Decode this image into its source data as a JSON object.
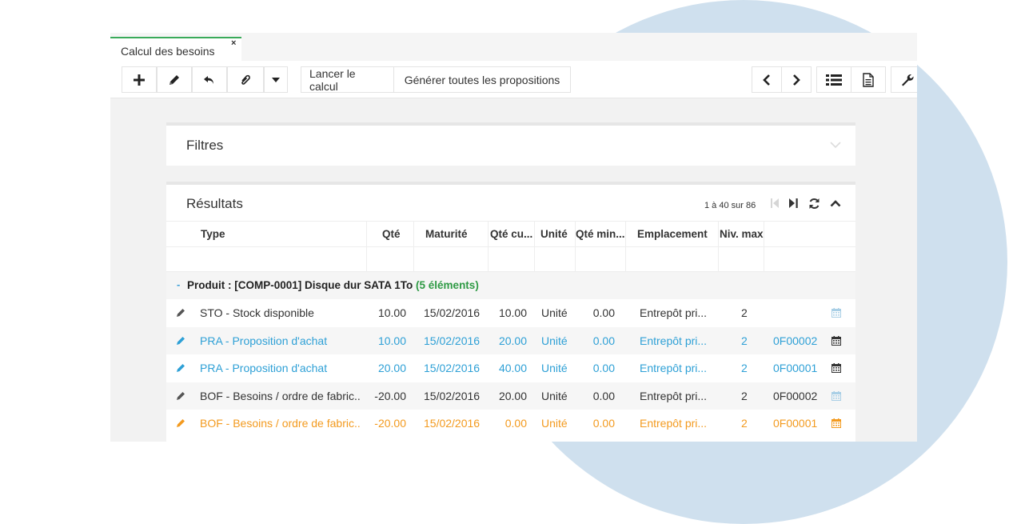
{
  "tab": {
    "label": "Calcul des besoins",
    "close": "×"
  },
  "toolbar": {
    "icons": [
      "plus-icon",
      "pencil-icon",
      "undo-icon",
      "paperclip-icon",
      "caret-down-icon"
    ],
    "launch_label": "Lancer le calcul",
    "generate_label": "Générer toutes les propositions",
    "right_icons": [
      "chevron-left-icon",
      "chevron-right-icon",
      "list-icon",
      "document-icon",
      "wrench-icon"
    ]
  },
  "filters": {
    "title": "Filtres"
  },
  "results": {
    "title": "Résultats",
    "pager": "1 à 40 sur 86",
    "columns": [
      "Type",
      "Qté",
      "Maturité",
      "Qté cu...",
      "Unité",
      "Qté min...",
      "Emplacement",
      "Niv. max"
    ],
    "group": {
      "toggle": "-",
      "label": "Produit : [COMP-0001] Disque dur SATA 1To",
      "count": "(5 éléments)"
    },
    "rows": [
      {
        "type": "STO - Stock disponible",
        "qty": "10.00",
        "maturity": "15/02/2016",
        "cum_qty": "10.00",
        "unit": "Unité",
        "min_qty": "0.00",
        "location": "Entrepôt pri...",
        "max_level": "2",
        "ref": "",
        "color": "dark"
      },
      {
        "type": "PRA - Proposition d'achat",
        "qty": "10.00",
        "maturity": "15/02/2016",
        "cum_qty": "20.00",
        "unit": "Unité",
        "min_qty": "0.00",
        "location": "Entrepôt pri...",
        "max_level": "2",
        "ref": "0F00002",
        "color": "blue"
      },
      {
        "type": "PRA - Proposition d'achat",
        "qty": "20.00",
        "maturity": "15/02/2016",
        "cum_qty": "40.00",
        "unit": "Unité",
        "min_qty": "0.00",
        "location": "Entrepôt pri...",
        "max_level": "2",
        "ref": "0F00001",
        "color": "blue"
      },
      {
        "type": "BOF - Besoins / ordre de fabric...",
        "qty": "-20.00",
        "maturity": "15/02/2016",
        "cum_qty": "20.00",
        "unit": "Unité",
        "min_qty": "0.00",
        "location": "Entrepôt pri...",
        "max_level": "2",
        "ref": "0F00002",
        "color": "dark"
      },
      {
        "type": "BOF - Besoins / ordre de fabric...",
        "qty": "-20.00",
        "maturity": "15/02/2016",
        "cum_qty": "0.00",
        "unit": "Unité",
        "min_qty": "0.00",
        "location": "Entrepôt pri...",
        "max_level": "2",
        "ref": "0F00001",
        "color": "orange"
      }
    ]
  },
  "colors": {
    "accent_green": "#3aaa5a",
    "blue": "#2ea0d6",
    "orange": "#f39a1e",
    "background_circle": "#cfe0ee"
  }
}
